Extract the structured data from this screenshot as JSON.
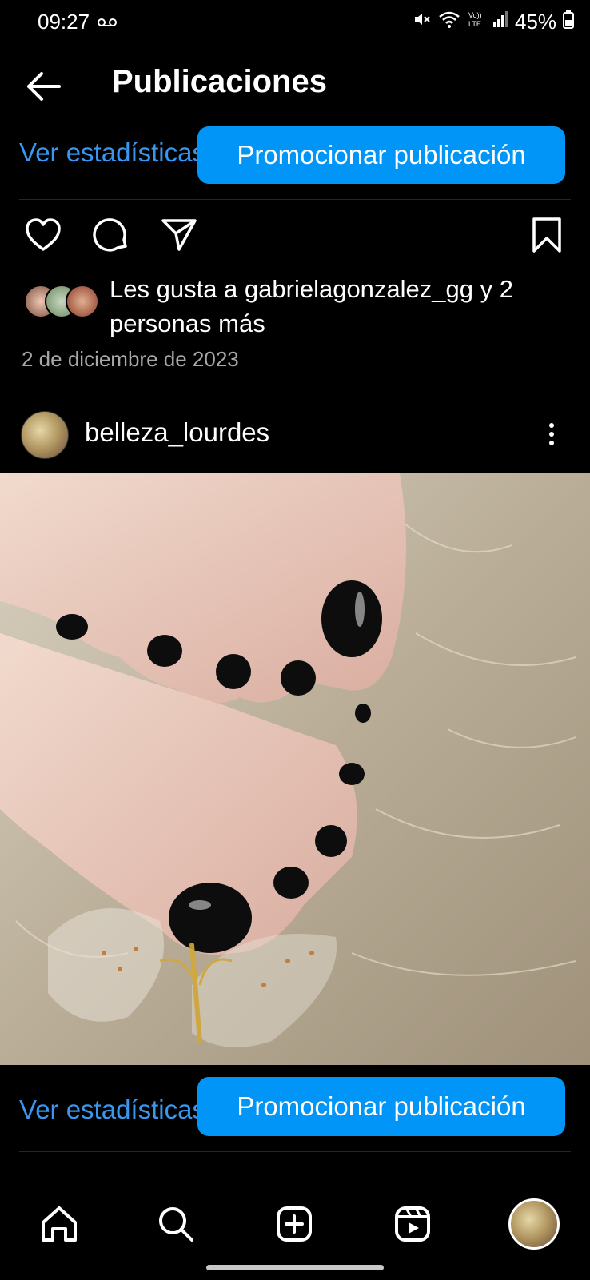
{
  "status_bar": {
    "time": "09:27",
    "battery": "45%",
    "icons": [
      "voicemail-icon",
      "mute-icon",
      "wifi-icon",
      "volte-icon",
      "signal-icon",
      "battery-icon"
    ]
  },
  "header": {
    "title": "Publicaciones",
    "back_icon": "arrow-left-icon"
  },
  "post_actions_top": {
    "stats_label": "Ver estadísticas",
    "promote_label": "Promocionar publicación"
  },
  "prev_post": {
    "likes_text": "Les gusta a gabrielagonzalez_gg y 2 personas más",
    "date": "2 de diciembre de 2023"
  },
  "post": {
    "username": "belleza_lourdes"
  },
  "post_actions_bottom": {
    "stats_label": "Ver estadísticas",
    "promote_label": "Promocionar publicación"
  },
  "nav": {
    "items": [
      "home-icon",
      "search-icon",
      "create-icon",
      "reels-icon",
      "profile-avatar"
    ]
  },
  "colors": {
    "accent": "#0095f6",
    "link": "#3897f0",
    "background": "#000000",
    "secondary_text": "#a8a8a8"
  }
}
